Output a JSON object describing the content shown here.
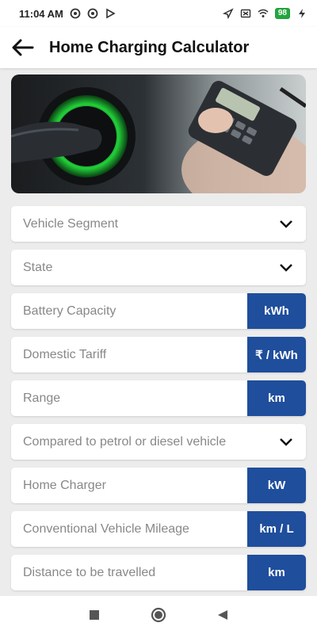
{
  "status": {
    "time": "11:04 AM",
    "battery": "98"
  },
  "header": {
    "title": "Home Charging Calculator"
  },
  "banner": {
    "description_icon": "ev-charging-calculator-image"
  },
  "form": {
    "vehicle_segment": {
      "label": "Vehicle Segment"
    },
    "state": {
      "label": "State"
    },
    "battery_capacity": {
      "label": "Battery Capacity",
      "unit": "kWh"
    },
    "domestic_tariff": {
      "label": "Domestic Tariff",
      "unit": "₹ / kWh"
    },
    "range": {
      "label": "Range",
      "unit": "km"
    },
    "compared_to": {
      "label": "Compared to petrol or diesel vehicle"
    },
    "home_charger": {
      "label": "Home Charger",
      "unit": "kW"
    },
    "conventional_mileage": {
      "label": "Conventional Vehicle Mileage",
      "unit": "km / L"
    },
    "distance": {
      "label": "Distance to be travelled",
      "unit": "km"
    }
  },
  "colors": {
    "unit_bg": "#1f4e9c",
    "charger_glow": "#22d13a"
  }
}
